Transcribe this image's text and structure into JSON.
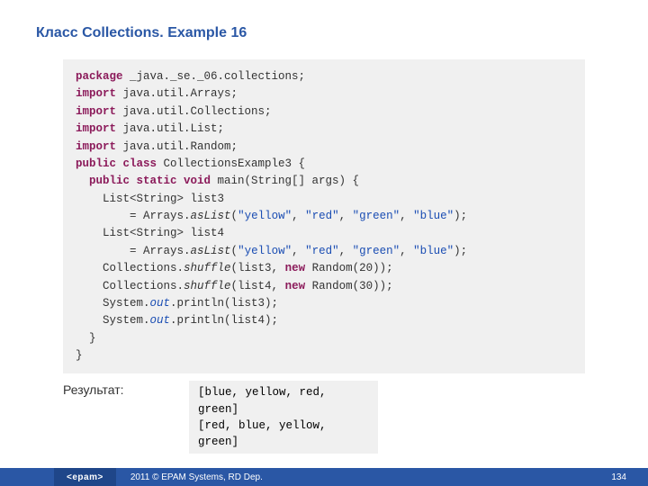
{
  "title": "Класс  Collections. Example 16",
  "code": {
    "l1a": "package",
    "l1b": " _java._se._06.collections;",
    "l2a": "import",
    "l2b": " java.util.Arrays;",
    "l3a": "import",
    "l3b": " java.util.Collections;",
    "l4a": "import",
    "l4b": " java.util.List;",
    "l5a": "import",
    "l5b": " java.util.Random;",
    "l6a": "public class",
    "l6b": " CollectionsExample3 {",
    "l7a": "  public static void",
    "l7b": " main(String[] args) {",
    "l8": "    List<String> list3",
    "l9a": "        = Arrays.",
    "l9b": "asList",
    "l9c": "(",
    "l9d": "\"yellow\"",
    "l9e": ", ",
    "l9f": "\"red\"",
    "l9g": ", ",
    "l9h": "\"green\"",
    "l9i": ", ",
    "l9j": "\"blue\"",
    "l9k": ");",
    "l10": "    List<String> list4",
    "l11a": "        = Arrays.",
    "l11b": "asList",
    "l11c": "(",
    "l11d": "\"yellow\"",
    "l11e": ", ",
    "l11f": "\"red\"",
    "l11g": ", ",
    "l11h": "\"green\"",
    "l11i": ", ",
    "l11j": "\"blue\"",
    "l11k": ");",
    "l12a": "    Collections.",
    "l12b": "shuffle",
    "l12c": "(list3, ",
    "l12d": "new",
    "l12e": " Random(20));",
    "l13a": "    Collections.",
    "l13b": "shuffle",
    "l13c": "(list4, ",
    "l13d": "new",
    "l13e": " Random(30));",
    "l14a": "    System.",
    "l14b": "out",
    "l14c": ".println(list3);",
    "l15a": "    System.",
    "l15b": "out",
    "l15c": ".println(list4);",
    "l16": "  }",
    "l17": "}"
  },
  "result_label": "Результат:",
  "output": "[blue, yellow, red, green]\n[red, blue, yellow, green]",
  "footer": {
    "logo": "epam",
    "copyright": "2011 © EPAM Systems, RD Dep.",
    "page": "134"
  }
}
